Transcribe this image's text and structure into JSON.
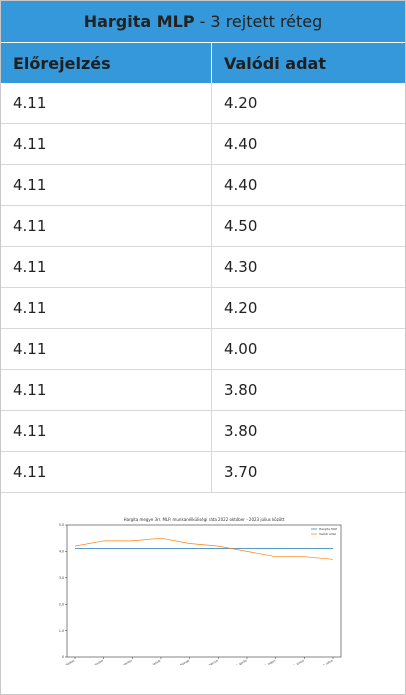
{
  "title": {
    "bold": "Hargita MLP",
    "rest": "- 3 rejtett réteg"
  },
  "table": {
    "headers": [
      "Előrejelzés",
      "Valódi adat"
    ],
    "rows": [
      [
        "4.11",
        "4.20"
      ],
      [
        "4.11",
        "4.40"
      ],
      [
        "4.11",
        "4.40"
      ],
      [
        "4.11",
        "4.50"
      ],
      [
        "4.11",
        "4.30"
      ],
      [
        "4.11",
        "4.20"
      ],
      [
        "4.11",
        "4.00"
      ],
      [
        "4.11",
        "3.80"
      ],
      [
        "4.11",
        "3.80"
      ],
      [
        "4.11",
        "3.70"
      ]
    ]
  },
  "chart_data": {
    "type": "line",
    "title": "Hargita megye 3rr. MLP. munkanélküliségi ráta 2022 október - 2023 július között",
    "x": [
      "2022. október",
      "2022. november",
      "2022. december",
      "2023. január",
      "2023. február",
      "2023. március",
      "2023. április",
      "2023. május",
      "2023. június",
      "2023. július"
    ],
    "ylim": [
      0,
      5.0
    ],
    "yticks": [
      "0",
      "1.0",
      "2.0",
      "3.0",
      "4.0",
      "5.0"
    ],
    "series": [
      {
        "name": "Hargita MLP",
        "color": "#1f77b4",
        "values": [
          4.11,
          4.11,
          4.11,
          4.11,
          4.11,
          4.11,
          4.11,
          4.11,
          4.11,
          4.11
        ]
      },
      {
        "name": "Valódi adat",
        "color": "#ff7f0e",
        "values": [
          4.2,
          4.4,
          4.4,
          4.5,
          4.3,
          4.2,
          4.0,
          3.8,
          3.8,
          3.7
        ]
      }
    ],
    "legend": "top-right",
    "grid": false
  }
}
